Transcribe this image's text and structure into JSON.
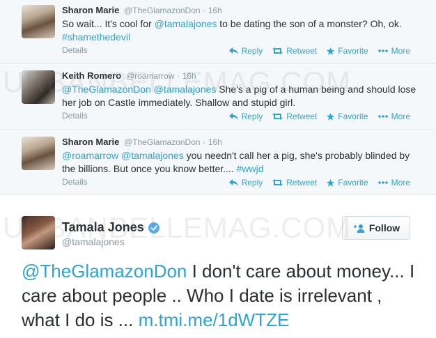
{
  "watermark": "URBANBELLEMAG.COM",
  "tweets": [
    {
      "name": "Sharon Marie",
      "handle": "@TheGlamazonDon",
      "time": "16h",
      "text_parts": [
        "So wait... It's cool for ",
        "@tamalajones",
        " to be dating the son of a monster? Oh, ok. ",
        "#shamethedevil"
      ],
      "details": "Details"
    },
    {
      "name": "Keith Romero",
      "handle": "@roamarrow",
      "time": "16h",
      "text_parts": [
        "@TheGlamazonDon",
        " ",
        "@tamalajones",
        " She's a pig of a human being and should lose her job on Castle immediately. Shallow and stupid girl."
      ],
      "details": "Details"
    },
    {
      "name": "Sharon Marie",
      "handle": "@TheGlamazonDon",
      "time": "16h",
      "text_parts": [
        "@roamarrow",
        " ",
        "@tamalajones",
        " you needn't call her a pig, she's probably blinded by the billions. But once you know better.... ",
        "#wwjd"
      ],
      "details": "Details"
    }
  ],
  "actions": {
    "reply": "Reply",
    "retweet": "Retweet",
    "favorite": "Favorite",
    "more": "More"
  },
  "main_tweet": {
    "name": "Tamala Jones",
    "handle": "@tamalajones",
    "follow_label": "Follow",
    "text_parts": [
      "@TheGlamazonDon",
      "  I don't care about money... I care about people .. Who I date is irrelevant , what I do is ... ",
      "m.tmi.me/1dWTZE"
    ]
  },
  "colors": {
    "link": "#2ba5d6",
    "verified": "#55acee",
    "background": "#f5f8fa"
  }
}
